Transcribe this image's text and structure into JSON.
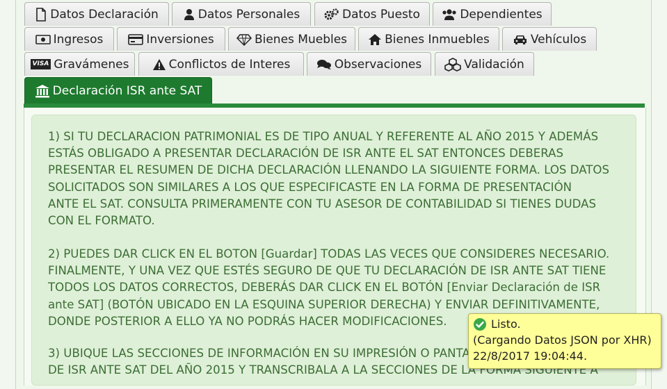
{
  "tabs": {
    "row1": [
      {
        "label": "Datos Declaración",
        "icon": "file-icon"
      },
      {
        "label": "Datos Personales",
        "icon": "user-icon"
      },
      {
        "label": "Datos Puesto",
        "icon": "gears-icon"
      },
      {
        "label": "Dependientes",
        "icon": "users-icon"
      }
    ],
    "row2": [
      {
        "label": "Ingresos",
        "icon": "money-icon"
      },
      {
        "label": "Inversiones",
        "icon": "credit-card-icon"
      },
      {
        "label": "Bienes Muebles",
        "icon": "diamond-icon"
      },
      {
        "label": "Bienes Inmuebles",
        "icon": "home-icon"
      },
      {
        "label": "Vehículos",
        "icon": "car-icon"
      }
    ],
    "row3": [
      {
        "label": "Gravámenes",
        "icon": "visa-icon",
        "icon_text": "VISA"
      },
      {
        "label": "Conflictos de Interes",
        "icon": "warning-icon"
      },
      {
        "label": "Observaciones",
        "icon": "comments-icon"
      },
      {
        "label": "Validación",
        "icon": "cubes-icon"
      }
    ],
    "row4": [
      {
        "label": "Declaración ISR ante SAT",
        "icon": "bank-icon",
        "active": true
      }
    ]
  },
  "instructions": {
    "p1": [
      "1) SI TU DECLARACION PATRIMONIAL ES DE TIPO ANUAL Y REFERENTE AL AÑO 2015 Y ADEMÁS",
      "ESTÁS OBLIGADO A PRESENTAR DECLARACIÓN DE ISR ANTE EL SAT ENTONCES DEBERAS",
      "PRESENTAR EL RESUMEN DE DICHA DECLARACIÓN LLENANDO LA SIGUIENTE FORMA. LOS DATOS",
      "SOLICITADOS SON SIMILARES A LOS QUE ESPECIFICASTE EN LA FORMA DE PRESENTACIÓN",
      "ANTE EL SAT. CONSULTA PRIMERAMENTE CON TU ASESOR DE CONTABILIDAD SI TIENES DUDAS",
      "CON EL FORMATO."
    ],
    "p2": [
      "2) PUEDES DAR CLICK EN EL BOTON [Guardar] TODAS LAS VECES QUE CONSIDERES NECESARIO.",
      "FINALMENTE, Y UNA VEZ QUE ESTÉS SEGURO DE QUE TU DECLARACIÓN DE ISR ANTE SAT TIENE",
      "TODOS LOS DATOS CORRECTOS, DEBERÁS DAR CLICK EN EL BOTÓN [Enviar Declaración de ISR",
      "ante SAT] (BOTÓN UBICADO EN LA ESQUINA SUPERIOR DERECHA) Y ENVIAR DEFINITIVAMENTE,",
      "DONDE POSTERIOR A ELLO YA NO PODRÁS HACER MODIFICACIONES."
    ],
    "p3": [
      "3) UBIQUE LAS SECCIONES DE INFORMACIÓN EN SU IMPRESIÓN O PANTALLA DE LA DECLARACIÓN",
      "DE ISR ANTE SAT DEL AÑO 2015 Y TRANSCRIBALA A LA SECCIONES DE LA FORMA SIGUIENTE A"
    ]
  },
  "toast": {
    "status": "Listo.",
    "detail": "(Cargando Datos JSON por XHR)",
    "timestamp": "22/8/2017 19:04:44."
  },
  "colors": {
    "active_tab": "#1d7a2e",
    "notice_bg": "#dff0d8",
    "notice_text": "#3c6e35",
    "toast_bg": "#ffff99",
    "check": "#3aa84a"
  }
}
